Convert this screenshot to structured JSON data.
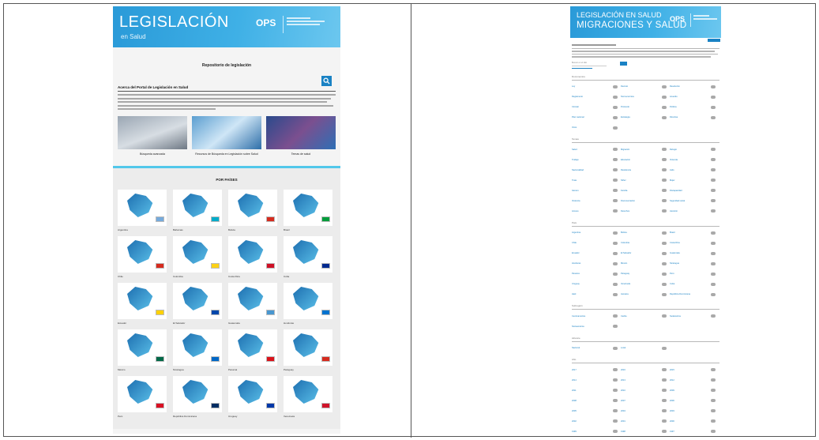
{
  "left_page": {
    "header": {
      "title": "LEGISLACIÓN",
      "subtitle": "en Salud",
      "org": "OPS"
    },
    "repository_title": "Repositorio de legislación",
    "about_heading": "Acerca del Portal de Legislación en Salud",
    "cards": [
      {
        "caption": "Búsqueda avanzada"
      },
      {
        "caption": "Recursos de Búsqueda en Legislación sobre Salud"
      },
      {
        "caption": "Temas de salud"
      }
    ],
    "by_country_title": "POR PAÍSES",
    "countries": [
      {
        "label": "Argentina",
        "flag": "#75aadb"
      },
      {
        "label": "Bahamas",
        "flag": "#00abc9"
      },
      {
        "label": "Bolivia",
        "flag": "#d52b1e"
      },
      {
        "label": "Brasil",
        "flag": "#009c3b"
      },
      {
        "label": "Chile",
        "flag": "#d52b1e"
      },
      {
        "label": "Colombia",
        "flag": "#fcd116"
      },
      {
        "label": "Costa Rica",
        "flag": "#ce1126"
      },
      {
        "label": "Cuba",
        "flag": "#002a8f"
      },
      {
        "label": "Ecuador",
        "flag": "#ffd100"
      },
      {
        "label": "El Salvador",
        "flag": "#0047ab"
      },
      {
        "label": "Guatemala",
        "flag": "#4997d0"
      },
      {
        "label": "Honduras",
        "flag": "#0073cf"
      },
      {
        "label": "México",
        "flag": "#006847"
      },
      {
        "label": "Nicaragua",
        "flag": "#0067c6"
      },
      {
        "label": "Panamá",
        "flag": "#da121a"
      },
      {
        "label": "Paraguay",
        "flag": "#d52b1e"
      },
      {
        "label": "Perú",
        "flag": "#d91023"
      },
      {
        "label": "República Dominicana",
        "flag": "#002d62"
      },
      {
        "label": "Uruguay",
        "flag": "#0038a8"
      },
      {
        "label": "Venezuela",
        "flag": "#cf142b"
      }
    ]
  },
  "right_page": {
    "header": {
      "line1": "LEGISLACIÓN EN SALUD",
      "line2": "MIGRACIONES Y SALUD",
      "org": "OPS"
    },
    "search_placeholder": "Buscar en el sitio",
    "groups": [
      {
        "title": "Documentos",
        "items": [
          "Ley",
          "Decreto",
          "Resolución",
          "Reglamento",
          "Norma técnica",
          "Acuerdo",
          "Circular",
          "Protocolo",
          "Política",
          "Plan nacional",
          "Estrategia",
          "Directiva",
          "Otros",
          "",
          ""
        ]
      },
      {
        "title": "Temas",
        "items": [
          "Salud",
          "Migración",
          "Refugio",
          "Trabajo",
          "Educación",
          "Vivienda",
          "Nacionalidad",
          "Residencia",
          "Asilo",
          "Trata",
          "Niñez",
          "Mujer",
          "Género",
          "Familia",
          "Discapacidad",
          "Violencia",
          "Documentación",
          "Seguridad social",
          "Acceso",
          "Derechos",
          "Atención"
        ]
      },
      {
        "title": "País",
        "items": [
          "Argentina",
          "Bolivia",
          "Brasil",
          "Chile",
          "Colombia",
          "Costa Rica",
          "Ecuador",
          "El Salvador",
          "Guatemala",
          "Honduras",
          "México",
          "Nicaragua",
          "Panamá",
          "Paraguay",
          "Perú",
          "Uruguay",
          "Venezuela",
          "Cuba",
          "Haití",
          "Jamaica",
          "República Dominicana"
        ]
      },
      {
        "title": "Subregión",
        "items": [
          "Centroamérica",
          "Caribe",
          "Sudamérica",
          "Norteamérica",
          "",
          ""
        ]
      },
      {
        "title": "Alcance",
        "items": [
          "Nacional",
          "Local",
          "",
          ""
        ]
      },
      {
        "title": "Año",
        "items": [
          "2017",
          "2016",
          "2015",
          "2014",
          "2013",
          "2012",
          "2011",
          "2010",
          "2009",
          "2008",
          "2007",
          "2006",
          "2005",
          "2004",
          "2003",
          "2002",
          "2001",
          "2000",
          "1999",
          "1998",
          "1997"
        ]
      }
    ]
  }
}
